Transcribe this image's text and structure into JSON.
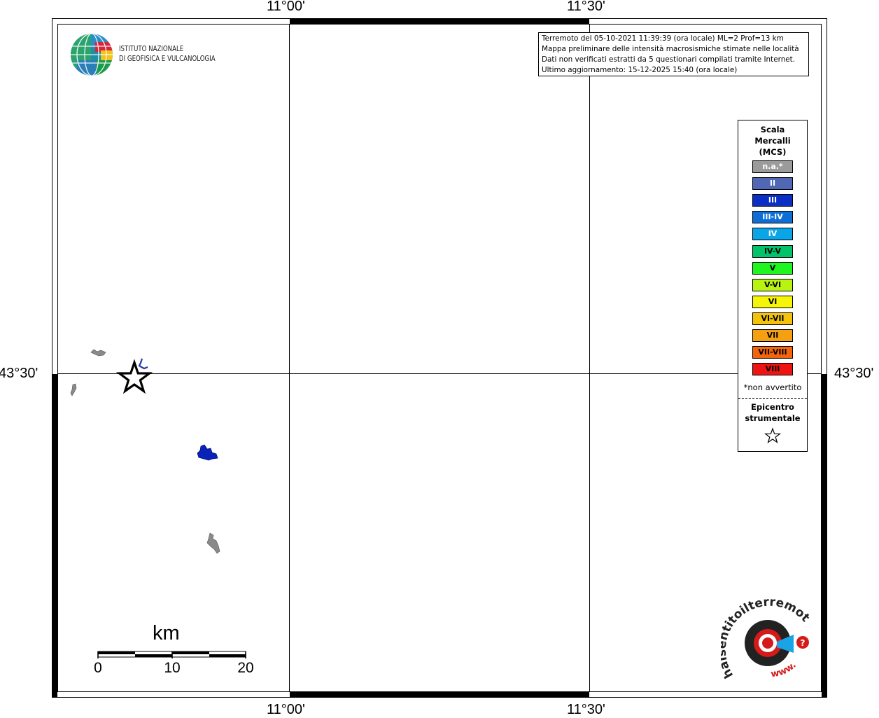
{
  "map": {
    "lon_ticks": [
      "11°00'",
      "11°30'"
    ],
    "lat_ticks": [
      "43°30'"
    ],
    "grid_color": "#000000"
  },
  "info": {
    "lines": [
      "Terremoto del 05-10-2021 11:39:39 (ora locale) ML=2 Prof=13 km",
      "Mappa preliminare delle intensità macrosismiche stimate nelle località",
      "Dati non verificati estratti da 5 questionari compilati tramite Internet.",
      "Ultimo aggiornamento: 15-12-2025 15:40 (ora locale)"
    ]
  },
  "logo_ingv": {
    "line1": "ISTITUTO NAZIONALE",
    "line2": "DI GEOFISICA E VULCANOLOGIA"
  },
  "legend": {
    "title": [
      "Scala",
      "Mercalli",
      "(MCS)"
    ],
    "classes": [
      {
        "label": "n.a.*",
        "color": "#9b9b9b",
        "text_color": "#ffffff"
      },
      {
        "label": "II",
        "color": "#4f67b5",
        "text_color": "#ffffff"
      },
      {
        "label": "III",
        "color": "#0a2fc2",
        "text_color": "#ffffff"
      },
      {
        "label": "III-IV",
        "color": "#0e6ed6",
        "text_color": "#ffffff"
      },
      {
        "label": "IV",
        "color": "#0aa5e6",
        "text_color": "#ffffff"
      },
      {
        "label": "IV-V",
        "color": "#00c36a",
        "text_color": "#000000"
      },
      {
        "label": "V",
        "color": "#1ff51f",
        "text_color": "#000000"
      },
      {
        "label": "V-VI",
        "color": "#b8f312",
        "text_color": "#000000"
      },
      {
        "label": "VI",
        "color": "#f5f50a",
        "text_color": "#000000"
      },
      {
        "label": "VI-VII",
        "color": "#f5c20a",
        "text_color": "#000000"
      },
      {
        "label": "VII",
        "color": "#f5a010",
        "text_color": "#000000"
      },
      {
        "label": "VII-VIII",
        "color": "#f3640b",
        "text_color": "#000000"
      },
      {
        "label": "VIII",
        "color": "#ee1414",
        "text_color": "#000000"
      }
    ],
    "na_note": "*non avvertito",
    "epicenter_label": [
      "Epicentro",
      "strumentale"
    ]
  },
  "scalebar": {
    "unit": "km",
    "labels": [
      "0",
      "10",
      "20"
    ]
  },
  "localities": [
    {
      "name": "area-grey-1",
      "color": "#8a8a8a"
    },
    {
      "name": "area-grey-2",
      "color": "#8a8a8a"
    },
    {
      "name": "area-blue-small",
      "color": "#1f3aa8"
    },
    {
      "name": "area-blue-large",
      "color": "#0a22b8"
    },
    {
      "name": "area-grey-3",
      "color": "#8a8a8a"
    }
  ],
  "hsi_logo": {
    "arc_text": "haisentitoilterremoto.it",
    "bottom_text": "www."
  }
}
